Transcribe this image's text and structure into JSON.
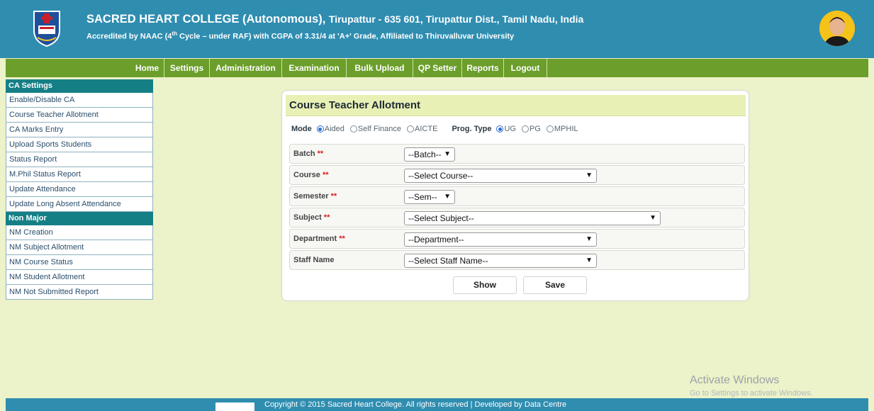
{
  "header": {
    "title_main": "SACRED HEART COLLEGE (Autonomous),",
    "title_rest": "Tirupattur - 635 601, Tirupattur Dist., Tamil Nadu, India",
    "subtitle_pre": "Accredited by NAAC (4",
    "subtitle_sup": "th",
    "subtitle_post": " Cycle – under RAF) with CGPA of 3.31/4 at 'A+' Grade, Affiliated to Thiruvalluvar University",
    "colors": {
      "header_bg": "#2f8db0",
      "nav_bg": "#6b9e2a",
      "page_bg": "#ecf2c9"
    }
  },
  "nav": {
    "items": [
      "Home",
      "Settings",
      "Administration",
      "Examination",
      "Bulk Upload",
      "QP Setter",
      "Reports",
      "Logout"
    ]
  },
  "sidebar": {
    "ca_heading": "CA Settings",
    "ca_items": [
      "Enable/Disable CA",
      "Course Teacher Allotment",
      "CA Marks Entry",
      "Upload Sports Students",
      "Status Report",
      "M.Phil Status Report",
      "Update Attendance",
      "Update Long Absent Attendance"
    ],
    "nm_heading": "Non Major",
    "nm_items": [
      "NM Creation",
      "NM Subject Allotment",
      "NM Course Status",
      "NM Student Allotment",
      "NM Not Submitted Report"
    ]
  },
  "form": {
    "title": "Course Teacher Allotment",
    "mode_label": "Mode",
    "mode_options": [
      "Aided",
      "Self Finance",
      "AICTE"
    ],
    "mode_selected": "Aided",
    "prog_label": "Prog. Type",
    "prog_options": [
      "UG",
      "PG",
      "MPHIL"
    ],
    "prog_selected": "UG",
    "required_mark": "**",
    "fields": [
      {
        "label": "Batch",
        "required": true,
        "value": "--Batch--"
      },
      {
        "label": "Course",
        "required": true,
        "value": "--Select Course--"
      },
      {
        "label": "Semester",
        "required": true,
        "value": "--Sem--"
      },
      {
        "label": "Subject",
        "required": true,
        "value": "--Select Subject--"
      },
      {
        "label": "Department",
        "required": true,
        "value": "--Department--"
      },
      {
        "label": "Staff Name",
        "required": false,
        "value": "--Select Staff Name--"
      }
    ],
    "show_label": "Show",
    "save_label": "Save"
  },
  "watermark": {
    "line1": "Activate Windows",
    "line2": "Go to Settings to activate Windows."
  },
  "footer": {
    "text": "Copyright © 2015 Sacred Heart College. All rights reserved  |  Developed by Data Centre"
  }
}
